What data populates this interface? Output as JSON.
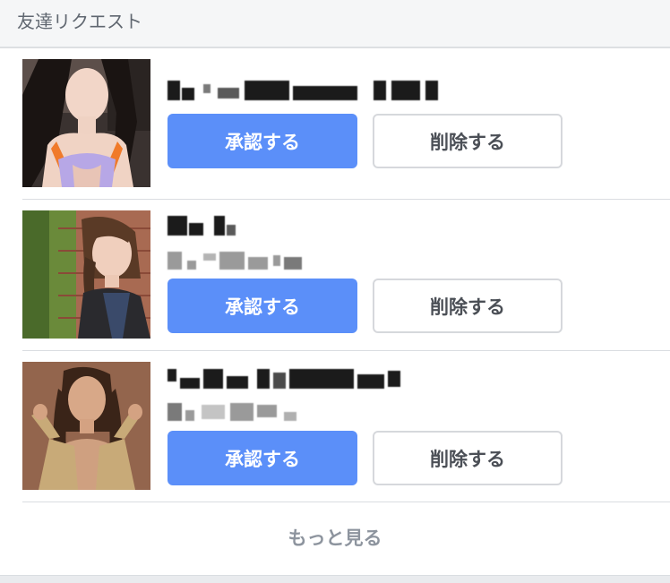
{
  "header": {
    "title": "友達リクエスト"
  },
  "requests": [
    {
      "name_redacted": true,
      "has_subtext": false,
      "confirm_label": "承認する",
      "delete_label": "削除する",
      "avatar_icon": "profile-photo-1"
    },
    {
      "name_redacted": true,
      "has_subtext": true,
      "confirm_label": "承認する",
      "delete_label": "削除する",
      "avatar_icon": "profile-photo-2"
    },
    {
      "name_redacted": true,
      "has_subtext": true,
      "confirm_label": "承認する",
      "delete_label": "削除する",
      "avatar_icon": "profile-photo-3"
    }
  ],
  "see_more": {
    "label": "もっと見る"
  },
  "colors": {
    "confirm_bg": "#5b8ff9",
    "confirm_text": "#ffffff",
    "delete_text": "#4b4f56",
    "delete_border": "#d6d8dc",
    "header_bg": "#f5f6f7",
    "header_text": "#606770",
    "see_more_text": "#8d949e"
  }
}
